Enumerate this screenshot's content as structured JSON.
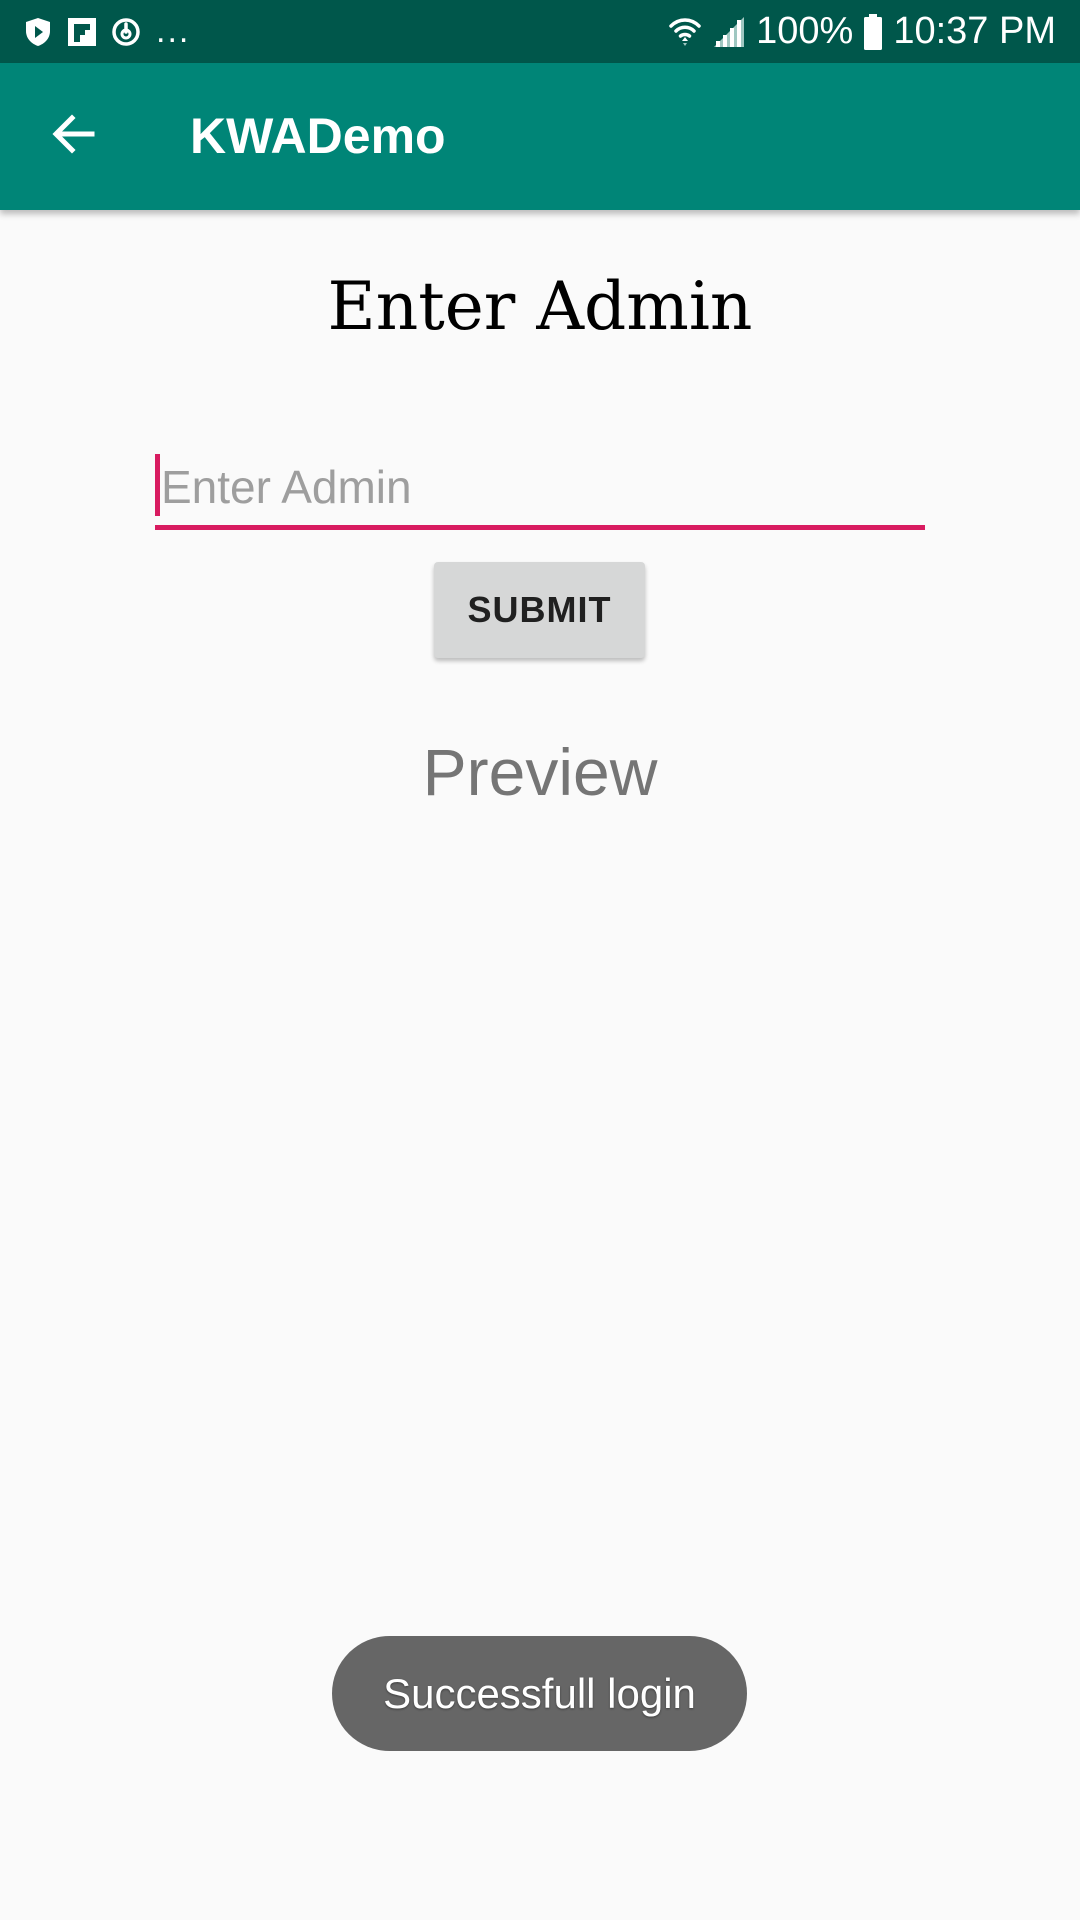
{
  "status_bar": {
    "left_icons": [
      "shield-play-icon",
      "flipboard-icon",
      "power-sync-icon"
    ],
    "more_indicator": "...",
    "battery_percent": "100%",
    "time": "10:37 PM",
    "right_icons": [
      "wifi-icon",
      "signal-icon",
      "battery-icon"
    ],
    "background_color": "#00574b"
  },
  "app_bar": {
    "title": "KWADemo",
    "back_icon": "arrow-back-icon",
    "background_color": "#008577"
  },
  "main": {
    "heading": "Enter Admin",
    "admin_input": {
      "value": "",
      "placeholder": "Enter Admin",
      "accent_color": "#d81b60"
    },
    "submit_label": "SUBMIT",
    "preview_label": "Preview"
  },
  "toast": {
    "message": "Successfull login"
  }
}
